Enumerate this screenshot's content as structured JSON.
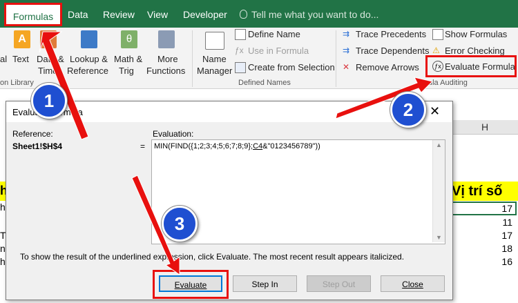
{
  "tabs": [
    "Formulas",
    "Data",
    "Review",
    "View",
    "Developer"
  ],
  "tell_me": "Tell me what you want to do...",
  "ribbon": {
    "cut_left_1": "al",
    "text_btn": "Text",
    "date_btn": [
      "Date &",
      "Time"
    ],
    "lookup_btn": [
      "Lookup &",
      "Reference"
    ],
    "math_btn": [
      "Math &",
      "Trig"
    ],
    "more_btn": [
      "More",
      "Functions"
    ],
    "library_group": "on Library",
    "name_manager": [
      "Name",
      "Manager"
    ],
    "define_name": "Define Name",
    "use_in_formula": "Use in Formula",
    "create_from_selection": "Create from Selection",
    "defined_names_group": "Defined Names",
    "trace_precedents": "Trace Precedents",
    "trace_dependents": "Trace Dependents",
    "remove_arrows": "Remove Arrows",
    "show_formulas": "Show Formulas",
    "error_checking": "Error Checking",
    "evaluate_formula": "Evaluate Formula",
    "auditing_group": "ula Auditing"
  },
  "sheet": {
    "col_h": "H",
    "header_left": "h",
    "header_right": "Vị trí số",
    "left_frags": [
      "h",
      "",
      "T",
      "ng",
      "h"
    ],
    "values": [
      "17",
      "11",
      "17",
      "18",
      "16"
    ]
  },
  "dialog": {
    "title": "Evaluate Formula",
    "reference_label": "Reference:",
    "reference_value": "Sheet1!$H$4",
    "equals": "=",
    "evaluation_label": "Evaluation:",
    "formula_prefix": "MIN(FIND({1;2;3;4;5;6;7;8;9};",
    "formula_underlined": "C4",
    "formula_suffix": "&\"0123456789\"))",
    "hint": "To show the result of the underlined expression, click Evaluate.  The most recent result appears italicized.",
    "buttons": {
      "evaluate": "Evaluate",
      "step_in": "Step In",
      "step_out": "Step Out",
      "close": "Close"
    }
  },
  "badges": [
    "1",
    "2",
    "3"
  ],
  "colors": {
    "excel_green": "#217346",
    "highlight_red": "#e8100e",
    "badge_blue": "#1f4fd1",
    "header_yellow": "#ffff00"
  }
}
